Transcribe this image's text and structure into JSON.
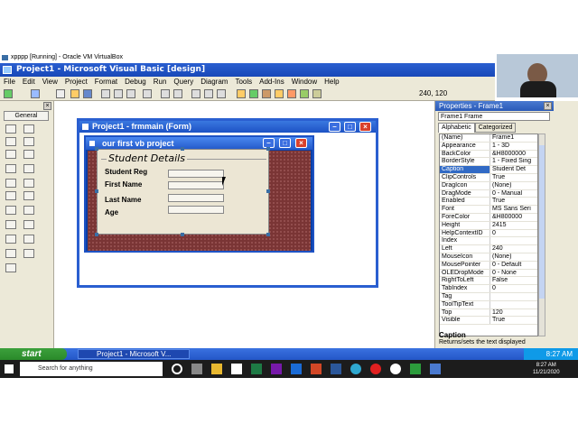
{
  "vbox": {
    "title": "xpppp [Running] - Oracle VM VirtualBox"
  },
  "ide": {
    "title": "Project1 - Microsoft Visual Basic [design]",
    "menus": [
      "File",
      "Edit",
      "View",
      "Project",
      "Format",
      "Debug",
      "Run",
      "Query",
      "Diagram",
      "Tools",
      "Add-Ins",
      "Window",
      "Help"
    ],
    "coords": "240, 120"
  },
  "toolbox": {
    "tab_label": "General"
  },
  "project_window": {
    "title": "Project1 - frmmain (Form)"
  },
  "form": {
    "title": "our first vb project",
    "frame_caption": "Student Details",
    "labels": [
      "Student Reg",
      "First Name",
      "Last Name",
      "Age"
    ]
  },
  "properties": {
    "title": "Properties - Frame1",
    "object": "Frame1  Frame",
    "tabs": [
      "Alphabetic",
      "Categorized"
    ],
    "rows": [
      {
        "name": "(Name)",
        "value": "Frame1"
      },
      {
        "name": "Appearance",
        "value": "1 - 3D"
      },
      {
        "name": "BackColor",
        "value": "&H8000000"
      },
      {
        "name": "BorderStyle",
        "value": "1 - Fixed Sing"
      },
      {
        "name": "Caption",
        "value": "Student Det"
      },
      {
        "name": "ClipControls",
        "value": "True"
      },
      {
        "name": "DragIcon",
        "value": "(None)"
      },
      {
        "name": "DragMode",
        "value": "0 - Manual"
      },
      {
        "name": "Enabled",
        "value": "True"
      },
      {
        "name": "Font",
        "value": "MS Sans Seri"
      },
      {
        "name": "ForeColor",
        "value": "&H800000"
      },
      {
        "name": "Height",
        "value": "2415"
      },
      {
        "name": "HelpContextID",
        "value": "0"
      },
      {
        "name": "Index",
        "value": ""
      },
      {
        "name": "Left",
        "value": "240"
      },
      {
        "name": "MouseIcon",
        "value": "(None)"
      },
      {
        "name": "MousePointer",
        "value": "0 - Default"
      },
      {
        "name": "OLEDropMode",
        "value": "0 - None"
      },
      {
        "name": "RightToLeft",
        "value": "False"
      },
      {
        "name": "TabIndex",
        "value": "0"
      },
      {
        "name": "Tag",
        "value": ""
      },
      {
        "name": "ToolTipText",
        "value": ""
      },
      {
        "name": "Top",
        "value": "120"
      },
      {
        "name": "Visible",
        "value": "True"
      }
    ],
    "selected_row": "Caption",
    "desc_title": "Caption",
    "desc_text": "Returns/sets the text displayed"
  },
  "xp_taskbar": {
    "start": "start",
    "task": "Project1 - Microsoft V...",
    "clock": "8:27 AM"
  },
  "win10_taskbar": {
    "search_placeholder": "Search for anything",
    "time": "8:27 AM",
    "date": "11/21/2020"
  },
  "colors": {
    "xp_blue": "#2456c8",
    "form_bg": "#7a3535",
    "frame_bg": "#ece6d4"
  }
}
